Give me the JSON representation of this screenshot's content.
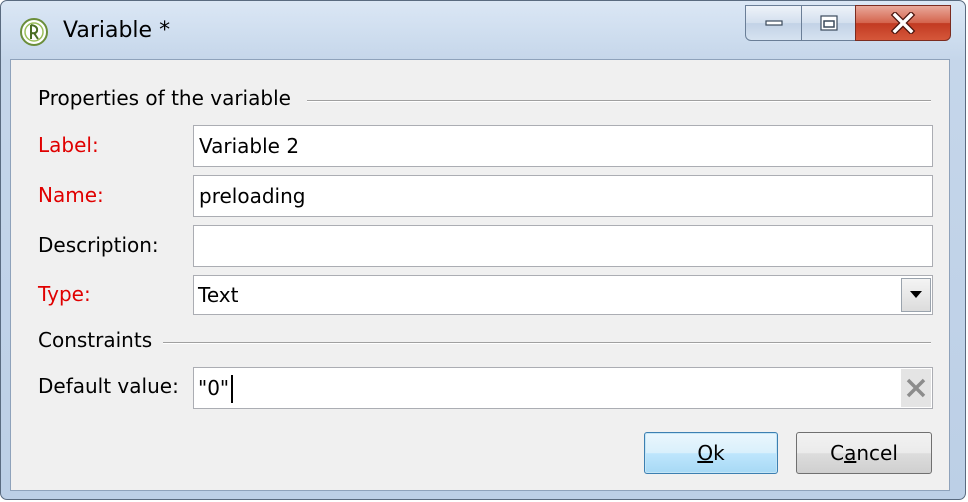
{
  "window": {
    "title": "Variable *"
  },
  "section_properties": {
    "title": "Properties of the variable"
  },
  "fields": {
    "label": {
      "caption": "Label:",
      "value": "Variable 2",
      "required": true
    },
    "name": {
      "caption": "Name:",
      "value": "preloading",
      "required": true
    },
    "description": {
      "caption": "Description:",
      "value": "",
      "required": false
    },
    "type": {
      "caption": "Type:",
      "value": "Text",
      "required": true
    }
  },
  "section_constraints": {
    "title": "Constraints"
  },
  "default_value": {
    "caption": "Default value:",
    "value": "\"0\""
  },
  "buttons": {
    "ok_mnemonic": "O",
    "ok_rest": "k",
    "cancel_pre": "C",
    "cancel_mnemonic": "a",
    "cancel_rest": "ncel"
  },
  "colors": {
    "required_label": "#e00000",
    "close_button": "#c23a22",
    "ok_border": "#3c7fb1"
  },
  "icons": {
    "app": "app-logo-icon",
    "minimize": "minimize-icon",
    "maximize": "maximize-icon",
    "close": "close-icon",
    "dropdown": "chevron-down-icon",
    "clear": "clear-x-icon"
  }
}
